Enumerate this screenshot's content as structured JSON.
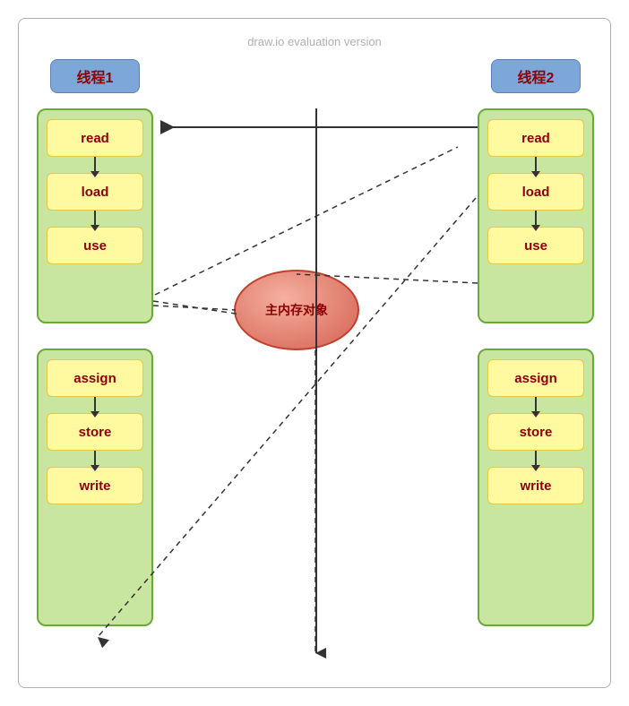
{
  "watermark": "draw.io evaluation version",
  "thread1": {
    "header": "线程1",
    "top_steps": [
      "read",
      "load",
      "use"
    ],
    "bottom_steps": [
      "assign",
      "store",
      "write"
    ]
  },
  "thread2": {
    "header": "线程2",
    "top_steps": [
      "read",
      "load",
      "use"
    ],
    "bottom_steps": [
      "assign",
      "store",
      "write"
    ]
  },
  "memory_label": "主内存对象",
  "colors": {
    "header_bg": "#7da7d9",
    "col_border": "#6aaa3a",
    "col_bg": "#c8e6a0",
    "step_bg": "#fff9a0",
    "step_border": "#e8c840",
    "text_dark_red": "#8b0000",
    "ellipse_fill": "#d46050"
  }
}
